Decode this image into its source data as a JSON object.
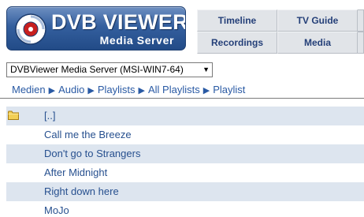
{
  "logo": {
    "title": "DVB VIEWER",
    "subtitle": "Media Server"
  },
  "tabs": [
    "Timeline",
    "TV Guide",
    "Recordings",
    "Media"
  ],
  "server_select": {
    "value": "DVBViewer Media Server (MSI-WIN7-64)"
  },
  "breadcrumb": [
    "Medien",
    "Audio",
    "Playlists",
    "All Playlists",
    "Playlist"
  ],
  "list": {
    "parent": "[..]",
    "items": [
      "Call me the Breeze",
      "Don't go to Strangers",
      "After Midnight",
      "Right down here",
      "MoJo"
    ]
  },
  "colors": {
    "accent": "#2a5aa4",
    "row_alt": "#dde5ef",
    "tab_bg": "#e1e4e8",
    "logo_bg": "#345f9e"
  },
  "icons": {
    "folder": "folder-icon",
    "logo_disc": "disc-icon",
    "dropdown": "chevron-down-icon"
  }
}
